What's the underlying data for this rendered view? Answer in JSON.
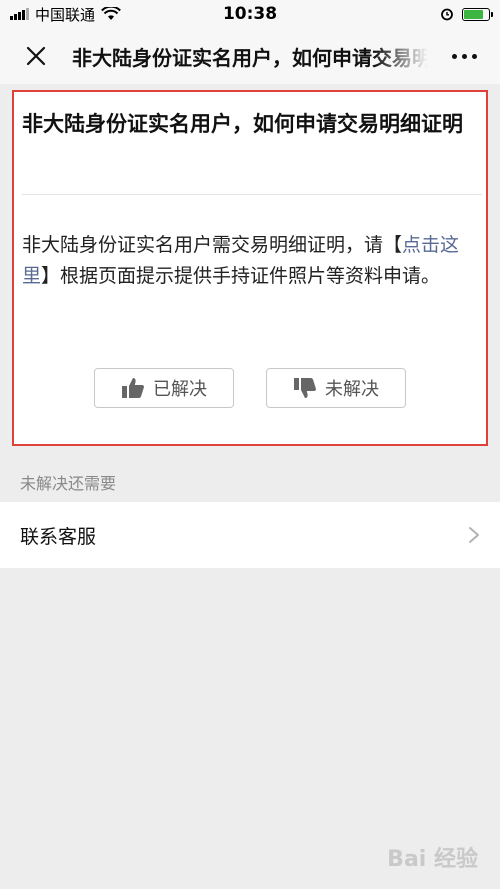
{
  "status_bar": {
    "carrier": "中国联通",
    "time": "10:38",
    "battery_level": 0.8,
    "battery_color": "#3cb541"
  },
  "nav": {
    "title": "非大陆身份证实名用户，如何申请交易明细证明",
    "close_icon": "close-icon",
    "more_icon": "more-icon"
  },
  "article": {
    "title": "非大陆身份证实名用户，如何申请交易明细证明",
    "body_before": "非大陆身份证实名用户需交易明细证明，请【",
    "body_link": "点击这里",
    "body_after": "】根据页面提示提供手持证件照片等资料申请。",
    "link_color": "#576b95",
    "highlight_border_color": "#e0403a",
    "resolved_label": "已解决",
    "unresolved_label": "未解决"
  },
  "section": {
    "header": "未解决还需要",
    "items": [
      {
        "label": "联系客服"
      }
    ]
  },
  "watermark": {
    "text": "Bai 经验"
  }
}
